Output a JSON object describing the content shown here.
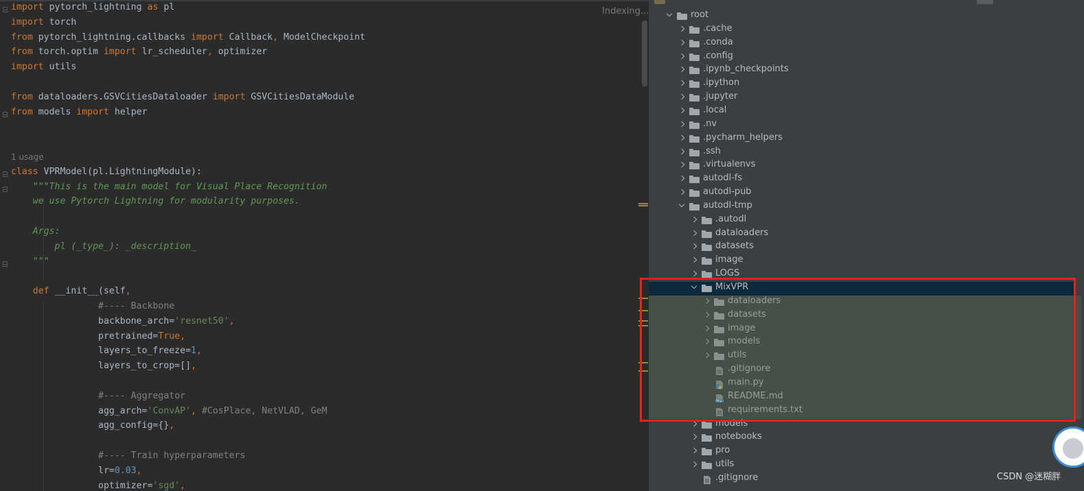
{
  "editor": {
    "status": "Indexing...",
    "usage_hint": "1 usage",
    "lines": [
      [
        [
          "kw",
          "import"
        ],
        [
          "t",
          " pytorch_lightning "
        ],
        [
          "kw",
          "as"
        ],
        [
          "t",
          " pl"
        ]
      ],
      [
        [
          "kw",
          "import"
        ],
        [
          "t",
          " torch"
        ]
      ],
      [
        [
          "kw",
          "from"
        ],
        [
          "t",
          " pytorch_lightning.callbacks "
        ],
        [
          "kw",
          "import"
        ],
        [
          "t",
          " Callback"
        ],
        [
          "kw",
          ","
        ],
        [
          "t",
          " ModelCheckpoint"
        ]
      ],
      [
        [
          "kw",
          "from"
        ],
        [
          "t",
          " torch.optim "
        ],
        [
          "kw",
          "import"
        ],
        [
          "t",
          " lr_scheduler"
        ],
        [
          "kw",
          ","
        ],
        [
          "t",
          " optimizer"
        ]
      ],
      [
        [
          "kw",
          "import"
        ],
        [
          "t",
          " utils"
        ]
      ],
      [],
      [
        [
          "kw",
          "from"
        ],
        [
          "t",
          " dataloaders.GSVCitiesDataloader "
        ],
        [
          "kw",
          "import"
        ],
        [
          "t",
          " GSVCitiesDataModule"
        ]
      ],
      [
        [
          "kw",
          "from"
        ],
        [
          "t",
          " models "
        ],
        [
          "kw",
          "import"
        ],
        [
          "t",
          " helper"
        ]
      ],
      [],
      [],
      [
        [
          "kw",
          "class"
        ],
        [
          "t",
          " VPRModel(pl.LightningModule):"
        ]
      ],
      [
        [
          "t",
          "    "
        ],
        [
          "doc",
          "\"\"\"This is the main model for Visual Place Recognition"
        ]
      ],
      [
        [
          "doc",
          "    we use Pytorch Lightning for modularity purposes."
        ]
      ],
      [],
      [
        [
          "doc",
          "    Args:"
        ]
      ],
      [
        [
          "doc",
          "        pl (_type_): _description_"
        ]
      ],
      [
        [
          "doc",
          "    \"\"\""
        ]
      ],
      [],
      [
        [
          "t",
          "    "
        ],
        [
          "kw",
          "def"
        ],
        [
          "t",
          " __init__(self"
        ],
        [
          "kw",
          ","
        ]
      ],
      [
        [
          "t",
          "                "
        ],
        [
          "cmt",
          "#---- Backbone"
        ]
      ],
      [
        [
          "t",
          "                backbone_arch="
        ],
        [
          "str",
          "'resnet50'"
        ],
        [
          "kw",
          ","
        ]
      ],
      [
        [
          "t",
          "                pretrained="
        ],
        [
          "kw",
          "True"
        ],
        [
          "kw",
          ","
        ]
      ],
      [
        [
          "t",
          "                layers_to_freeze="
        ],
        [
          "num",
          "1"
        ],
        [
          "kw",
          ","
        ]
      ],
      [
        [
          "t",
          "                layers_to_crop=[]"
        ],
        [
          "kw",
          ","
        ]
      ],
      [],
      [
        [
          "t",
          "                "
        ],
        [
          "cmt",
          "#---- Aggregator"
        ]
      ],
      [
        [
          "t",
          "                agg_arch="
        ],
        [
          "str",
          "'ConvAP'"
        ],
        [
          "kw",
          ","
        ],
        [
          "t",
          " "
        ],
        [
          "cmt",
          "#CosPlace, NetVLAD, GeM"
        ]
      ],
      [
        [
          "t",
          "                agg_config={}"
        ],
        [
          "kw",
          ","
        ]
      ],
      [],
      [
        [
          "t",
          "                "
        ],
        [
          "cmt",
          "#---- Train hyperparameters"
        ]
      ],
      [
        [
          "t",
          "                lr="
        ],
        [
          "num",
          "0.03"
        ],
        [
          "kw",
          ","
        ]
      ],
      [
        [
          "t",
          "                optimizer="
        ],
        [
          "str",
          "'sgd'"
        ],
        [
          "kw",
          ","
        ]
      ]
    ]
  },
  "tree": {
    "items": [
      {
        "label": "root",
        "depth": 0,
        "type": "folder",
        "state": "expanded"
      },
      {
        "label": ".cache",
        "depth": 1,
        "type": "folder",
        "state": "collapsed"
      },
      {
        "label": ".conda",
        "depth": 1,
        "type": "folder",
        "state": "collapsed"
      },
      {
        "label": ".config",
        "depth": 1,
        "type": "folder",
        "state": "collapsed"
      },
      {
        "label": ".ipynb_checkpoints",
        "depth": 1,
        "type": "folder",
        "state": "collapsed"
      },
      {
        "label": ".ipython",
        "depth": 1,
        "type": "folder",
        "state": "collapsed"
      },
      {
        "label": ".jupyter",
        "depth": 1,
        "type": "folder",
        "state": "collapsed"
      },
      {
        "label": ".local",
        "depth": 1,
        "type": "folder",
        "state": "collapsed"
      },
      {
        "label": ".nv",
        "depth": 1,
        "type": "folder",
        "state": "collapsed"
      },
      {
        "label": ".pycharm_helpers",
        "depth": 1,
        "type": "folder",
        "state": "collapsed"
      },
      {
        "label": ".ssh",
        "depth": 1,
        "type": "folder",
        "state": "collapsed"
      },
      {
        "label": ".virtualenvs",
        "depth": 1,
        "type": "folder",
        "state": "collapsed"
      },
      {
        "label": "autodl-fs",
        "depth": 1,
        "type": "folder",
        "state": "collapsed"
      },
      {
        "label": "autodl-pub",
        "depth": 1,
        "type": "folder",
        "state": "collapsed"
      },
      {
        "label": "autodl-tmp",
        "depth": 1,
        "type": "folder",
        "state": "expanded"
      },
      {
        "label": ".autodl",
        "depth": 2,
        "type": "folder",
        "state": "collapsed"
      },
      {
        "label": "dataloaders",
        "depth": 2,
        "type": "folder",
        "state": "collapsed"
      },
      {
        "label": "datasets",
        "depth": 2,
        "type": "folder",
        "state": "collapsed"
      },
      {
        "label": "image",
        "depth": 2,
        "type": "folder",
        "state": "collapsed"
      },
      {
        "label": "LOGS",
        "depth": 2,
        "type": "folder",
        "state": "collapsed"
      },
      {
        "label": "MixVPR",
        "depth": 2,
        "type": "folder",
        "state": "expanded",
        "selected": true
      },
      {
        "label": "dataloaders",
        "depth": 3,
        "type": "folder",
        "state": "collapsed"
      },
      {
        "label": "datasets",
        "depth": 3,
        "type": "folder",
        "state": "collapsed"
      },
      {
        "label": "image",
        "depth": 3,
        "type": "folder",
        "state": "collapsed"
      },
      {
        "label": "models",
        "depth": 3,
        "type": "folder",
        "state": "collapsed"
      },
      {
        "label": "utils",
        "depth": 3,
        "type": "folder",
        "state": "collapsed"
      },
      {
        "label": ".gitignore",
        "depth": 3,
        "type": "file",
        "icon": "text"
      },
      {
        "label": "main.py",
        "depth": 3,
        "type": "file",
        "icon": "python"
      },
      {
        "label": "README.md",
        "depth": 3,
        "type": "file",
        "icon": "markdown"
      },
      {
        "label": "requirements.txt",
        "depth": 3,
        "type": "file",
        "icon": "text"
      },
      {
        "label": "models",
        "depth": 2,
        "type": "folder",
        "state": "collapsed"
      },
      {
        "label": "notebooks",
        "depth": 2,
        "type": "folder",
        "state": "collapsed"
      },
      {
        "label": "pro",
        "depth": 2,
        "type": "folder",
        "state": "collapsed"
      },
      {
        "label": "utils",
        "depth": 2,
        "type": "folder",
        "state": "collapsed"
      },
      {
        "label": ".gitignore",
        "depth": 2,
        "type": "file",
        "icon": "text"
      }
    ]
  },
  "watermark": "CSDN @迷糊胖",
  "colors": {
    "keyword": "#cc7832",
    "string": "#6a8759",
    "number": "#6897bb",
    "comment": "#808080",
    "docstring": "#629755",
    "selection": "#0d293e",
    "annotation_frame": "#e2231a"
  }
}
